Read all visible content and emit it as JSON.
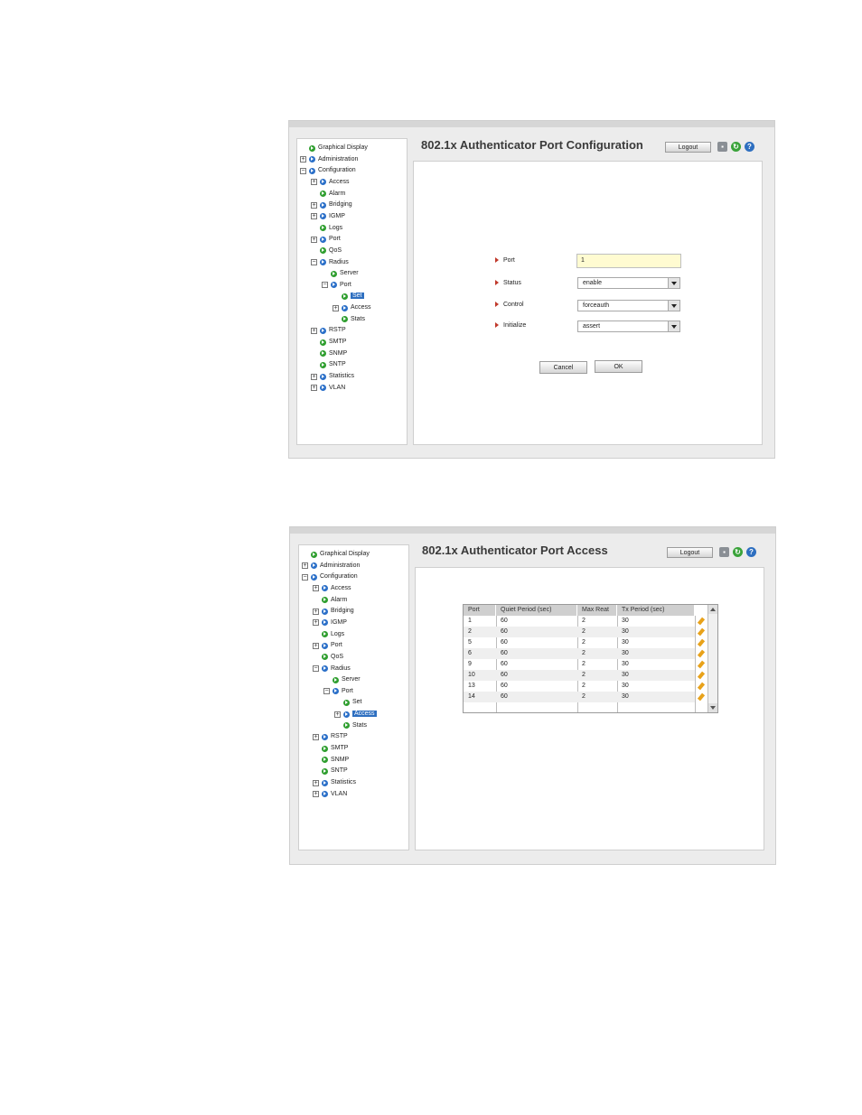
{
  "screen1": {
    "title": "802.1x Authenticator Port Configuration",
    "logout_label": "Logout",
    "icons": [
      "save-icon",
      "refresh-icon",
      "help-icon"
    ],
    "tree": [
      {
        "label": "Graphical Display",
        "toggle": ""
      },
      {
        "label": "Administration",
        "toggle": "+"
      },
      {
        "label": "Configuration",
        "toggle": "−"
      },
      {
        "label": "Access",
        "toggle": "+"
      },
      {
        "label": "Alarm",
        "toggle": ""
      },
      {
        "label": "Bridging",
        "toggle": "+"
      },
      {
        "label": "IGMP",
        "toggle": "+"
      },
      {
        "label": "Logs",
        "toggle": ""
      },
      {
        "label": "Port",
        "toggle": "+"
      },
      {
        "label": "QoS",
        "toggle": ""
      },
      {
        "label": "Radius",
        "toggle": "−"
      },
      {
        "label": "Server",
        "toggle": ""
      },
      {
        "label": "Port",
        "toggle": "−"
      },
      {
        "label": "Set",
        "toggle": "",
        "selected": true
      },
      {
        "label": "Access",
        "toggle": "+"
      },
      {
        "label": "Stats",
        "toggle": ""
      },
      {
        "label": "RSTP",
        "toggle": "+"
      },
      {
        "label": "SMTP",
        "toggle": ""
      },
      {
        "label": "SNMP",
        "toggle": ""
      },
      {
        "label": "SNTP",
        "toggle": ""
      },
      {
        "label": "Statistics",
        "toggle": "+"
      },
      {
        "label": "VLAN",
        "toggle": "+"
      }
    ],
    "form": {
      "port_label": "Port",
      "port_value": "1",
      "status_label": "Status",
      "status_value": "enable",
      "control_label": "Control",
      "control_value": "forceauth",
      "initialize_label": "Initialize",
      "initialize_value": "assert",
      "cancel_label": "Cancel",
      "ok_label": "OK"
    }
  },
  "screen2": {
    "title": "802.1x Authenticator Port Access",
    "logout_label": "Logout",
    "icons": [
      "save-icon",
      "refresh-icon",
      "help-icon"
    ],
    "tree": [
      {
        "label": "Graphical Display",
        "toggle": ""
      },
      {
        "label": "Administration",
        "toggle": "+"
      },
      {
        "label": "Configuration",
        "toggle": "−"
      },
      {
        "label": "Access",
        "toggle": "+"
      },
      {
        "label": "Alarm",
        "toggle": ""
      },
      {
        "label": "Bridging",
        "toggle": "+"
      },
      {
        "label": "IGMP",
        "toggle": "+"
      },
      {
        "label": "Logs",
        "toggle": ""
      },
      {
        "label": "Port",
        "toggle": "+"
      },
      {
        "label": "QoS",
        "toggle": ""
      },
      {
        "label": "Radius",
        "toggle": "−"
      },
      {
        "label": "Server",
        "toggle": ""
      },
      {
        "label": "Port",
        "toggle": "−"
      },
      {
        "label": "Set",
        "toggle": ""
      },
      {
        "label": "Access",
        "toggle": "+",
        "selected": true
      },
      {
        "label": "Stats",
        "toggle": ""
      },
      {
        "label": "RSTP",
        "toggle": "+"
      },
      {
        "label": "SMTP",
        "toggle": ""
      },
      {
        "label": "SNMP",
        "toggle": ""
      },
      {
        "label": "SNTP",
        "toggle": ""
      },
      {
        "label": "Statistics",
        "toggle": "+"
      },
      {
        "label": "VLAN",
        "toggle": "+"
      }
    ],
    "table": {
      "headers": [
        "Port",
        "Quiet Period (sec)",
        "Max Reat",
        "Tx Period (sec)"
      ],
      "rows": [
        [
          "1",
          "60",
          "2",
          "30"
        ],
        [
          "2",
          "60",
          "2",
          "30"
        ],
        [
          "5",
          "60",
          "2",
          "30"
        ],
        [
          "6",
          "60",
          "2",
          "30"
        ],
        [
          "9",
          "60",
          "2",
          "30"
        ],
        [
          "10",
          "60",
          "2",
          "30"
        ],
        [
          "13",
          "60",
          "2",
          "30"
        ],
        [
          "14",
          "60",
          "2",
          "30"
        ]
      ]
    }
  }
}
